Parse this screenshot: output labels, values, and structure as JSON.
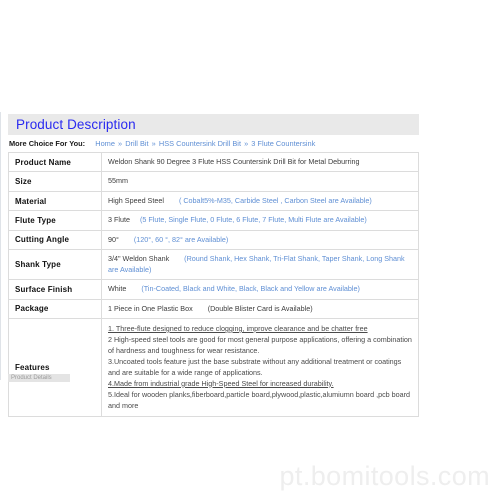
{
  "section": {
    "title": "Product Description"
  },
  "breadcrumb": {
    "label": "More Choice For You:",
    "separator": "»",
    "items": [
      "Home",
      "Drill Bit",
      "HSS Countersink Drill Bit",
      "3 Flute Countersink"
    ]
  },
  "spec_table": {
    "rows": [
      {
        "key": "Product Name",
        "value": "Weldon Shank 90 Degree 3 Flute HSS Countersink Drill Bit  for Metal Deburring",
        "note": ""
      },
      {
        "key": "Size",
        "value": "55mm",
        "note": ""
      },
      {
        "key": "Material",
        "value": "High Speed Steel",
        "note": "( Cobalt5%-M35, Carbide Steel , Carbon Steel are Available)"
      },
      {
        "key": "Flute Type",
        "value": "3 Flute",
        "note": "(5 Flute, Single Flute, 0 Flute,  6 Flute, 7 Flute, Multi Flute are Available)"
      },
      {
        "key": "Cutting Angle",
        "value": "90°",
        "note": "(120°, 60 °, 82° are Available)"
      },
      {
        "key": "Shank Type",
        "value": "3/4\" Weldon Shank",
        "note": "(Round Shank, Hex Shank,  Tri-Flat Shank, Taper Shank,  Long Shank  are Available)"
      },
      {
        "key": "Surface Finish",
        "value": "White",
        "note": "(Tin-Coated, Black and White, Black, Black and Yellow are Available)"
      },
      {
        "key": "Package",
        "value": "1 Piece in One Plastic Box",
        "note": "(Double Blister Card is Available)"
      }
    ],
    "features": {
      "key": "Features",
      "lines": [
        "1. Three-flute designed to reduce clogging, improve clearance and be chatter free",
        "2 High-speed steel tools are good for most general purpose applications, offering a combination of hardness and toughness for wear resistance.",
        "3.Uncoated tools feature just the base substrate without any additional treatment or coatings and are suitable for a wide range of applications.",
        "4.Made from industrial grade High-Speed Steel for increased durability.",
        "5.Ideal for wooden planks,fiberboard,particle board,plywood,plastic,alumiumn board ,pcb board and more"
      ]
    }
  },
  "stub": {
    "text": "Product Details"
  },
  "watermark": {
    "text": "pt.bomitools.com"
  },
  "colors": {
    "accent_blue": "#5f8fd4",
    "title_blue": "#2a2af0",
    "bar_gray": "#e9e9e9",
    "border_gray": "#dcdcdc",
    "watermark_gray": "#eeeeee"
  }
}
